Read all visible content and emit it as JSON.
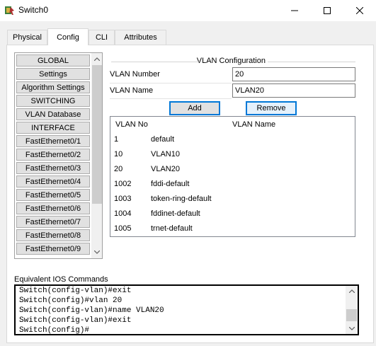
{
  "window": {
    "title": "Switch0",
    "min_glyph": "—",
    "max_glyph": "☐",
    "close_glyph": "✕"
  },
  "tabs": [
    {
      "label": "Physical"
    },
    {
      "label": "Config"
    },
    {
      "label": "CLI"
    },
    {
      "label": "Attributes"
    }
  ],
  "sidebar": {
    "items": [
      {
        "label": "GLOBAL"
      },
      {
        "label": "Settings"
      },
      {
        "label": "Algorithm Settings"
      },
      {
        "label": "SWITCHING"
      },
      {
        "label": "VLAN Database"
      },
      {
        "label": "INTERFACE"
      },
      {
        "label": "FastEthernet0/1"
      },
      {
        "label": "FastEthernet0/2"
      },
      {
        "label": "FastEthernet0/3"
      },
      {
        "label": "FastEthernet0/4"
      },
      {
        "label": "FastEthernet0/5"
      },
      {
        "label": "FastEthernet0/6"
      },
      {
        "label": "FastEthernet0/7"
      },
      {
        "label": "FastEthernet0/8"
      },
      {
        "label": "FastEthernet0/9"
      }
    ]
  },
  "vlan_config": {
    "title": "VLAN Configuration",
    "number_label": "VLAN Number",
    "number_value": "20",
    "name_label": "VLAN Name",
    "name_value": "VLAN20",
    "add_label": "Add",
    "remove_label": "Remove",
    "table": {
      "headers": {
        "no": "VLAN No",
        "name": "VLAN Name"
      },
      "rows": [
        {
          "no": "1",
          "name": "default"
        },
        {
          "no": "10",
          "name": "VLAN10"
        },
        {
          "no": "20",
          "name": "VLAN20"
        },
        {
          "no": "1002",
          "name": "fddi-default"
        },
        {
          "no": "1003",
          "name": "token-ring-default"
        },
        {
          "no": "1004",
          "name": "fddinet-default"
        },
        {
          "no": "1005",
          "name": "trnet-default"
        }
      ]
    }
  },
  "ios": {
    "label": "Equivalent IOS Commands",
    "lines": [
      "Switch(config-vlan)#exit",
      "Switch(config)#vlan 20",
      "Switch(config-vlan)#name VLAN20",
      "Switch(config-vlan)#exit",
      "Switch(config)#"
    ]
  }
}
